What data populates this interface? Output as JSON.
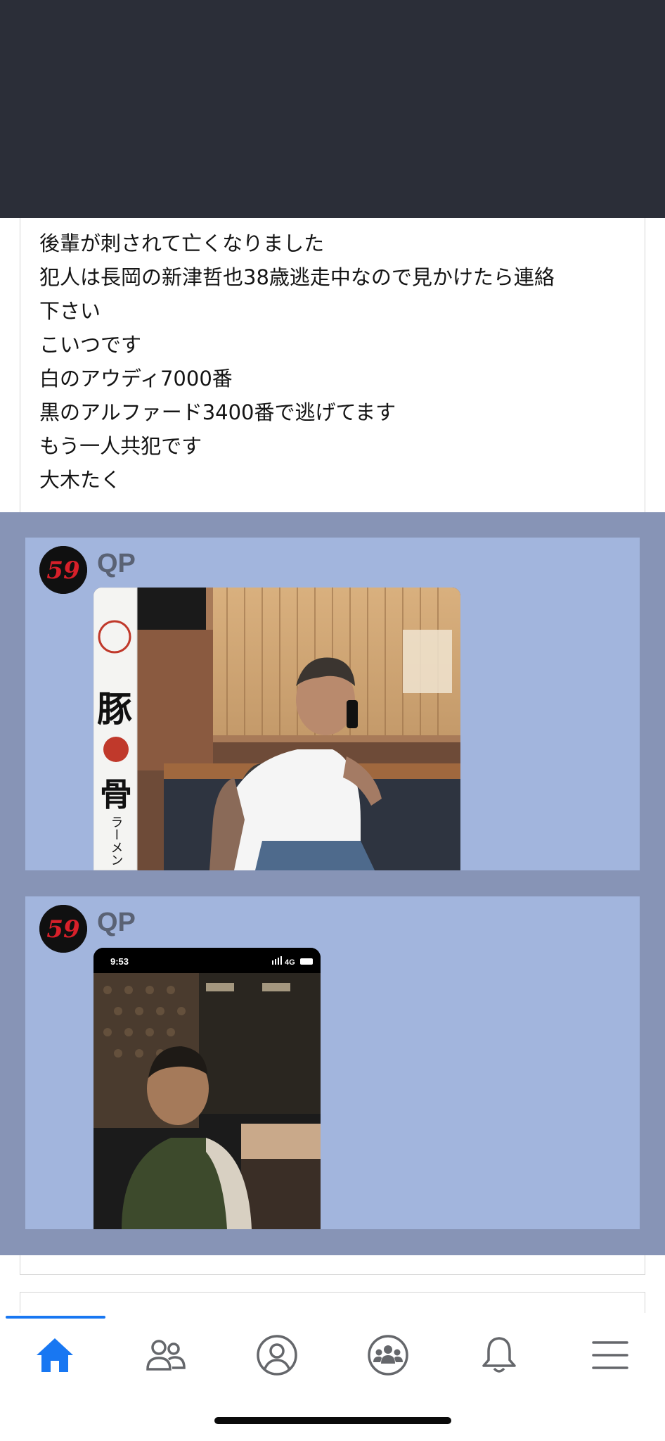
{
  "post": {
    "lines": [
      "後輩が刺されて亡くなりました",
      "犯人は長岡の新津哲也38歳逃走中なので見かけたら連絡",
      "下さい",
      "こいつです",
      "白のアウディ7000番",
      "黒のアルファード3400番で逃げてます",
      "もう一人共犯です",
      "大木たく"
    ]
  },
  "messages": [
    {
      "sender": "QP",
      "avatar_text": "59",
      "photo_signs": {
        "vertical_1": "豚",
        "vertical_2": "骨",
        "vertical_3": "ラーメン"
      }
    },
    {
      "sender": "QP",
      "avatar_text": "59",
      "phone_status": {
        "time": "9:53",
        "network": "4G"
      }
    }
  ],
  "tabbar": {
    "items": [
      {
        "icon": "home-icon",
        "active": true
      },
      {
        "icon": "friends-icon",
        "active": false
      },
      {
        "icon": "profile-icon",
        "active": false
      },
      {
        "icon": "groups-icon",
        "active": false
      },
      {
        "icon": "bell-icon",
        "active": false
      },
      {
        "icon": "menu-icon",
        "active": false
      }
    ],
    "active_color": "#1877f2",
    "inactive_color": "#65676b"
  }
}
